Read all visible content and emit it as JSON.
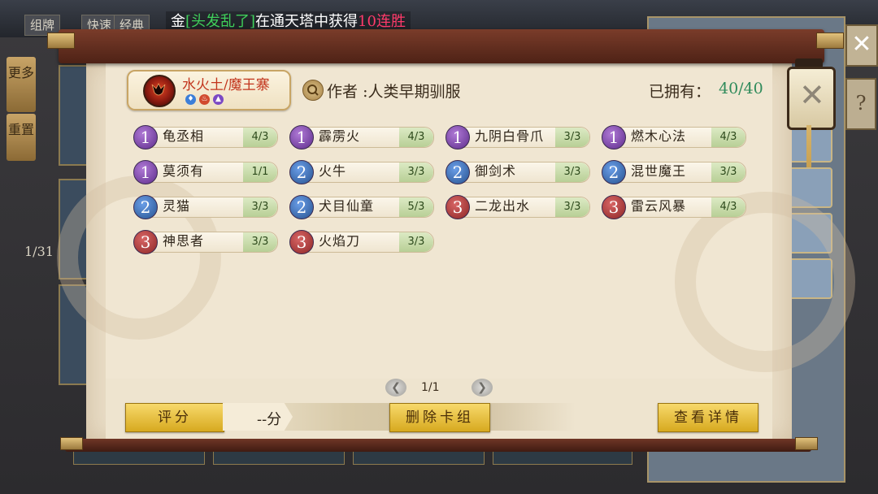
{
  "background": {
    "tabs": [
      "组牌",
      "快速",
      "经典"
    ],
    "side_buttons": [
      "更多",
      "重置"
    ],
    "page_indicator": "1/31",
    "marquee": {
      "prefix": "金",
      "name": "[头发乱了]",
      "text": "在通天塔中获得",
      "highlight": "10连胜"
    }
  },
  "deck": {
    "name": "水火土/魔王寨",
    "elements": [
      {
        "icon": "water-icon",
        "color": "#3d7fd8",
        "glyph": "♦"
      },
      {
        "icon": "fire-icon",
        "color": "#d14a2e",
        "glyph": "♨"
      },
      {
        "icon": "earth-icon",
        "color": "#7b4ac4",
        "glyph": "▲"
      }
    ],
    "author_label": "作者",
    "author_value": ":人类早期驯服",
    "owned_label": "已拥有：",
    "owned_value": "40/40"
  },
  "cards": [
    {
      "cost": "1",
      "name": "龟丞相",
      "count": "4/3"
    },
    {
      "cost": "1",
      "name": "霹雳火",
      "count": "4/3"
    },
    {
      "cost": "1",
      "name": "九阴白骨爪",
      "count": "3/3"
    },
    {
      "cost": "1",
      "name": "燃木心法",
      "count": "4/3"
    },
    {
      "cost": "1",
      "name": "莫须有",
      "count": "1/1"
    },
    {
      "cost": "2",
      "name": "火牛",
      "count": "3/3"
    },
    {
      "cost": "2",
      "name": "御剑术",
      "count": "3/3"
    },
    {
      "cost": "2",
      "name": "混世魔王",
      "count": "3/3"
    },
    {
      "cost": "2",
      "name": "灵猫",
      "count": "3/3"
    },
    {
      "cost": "2",
      "name": "犬目仙童",
      "count": "5/3"
    },
    {
      "cost": "3",
      "name": "二龙出水",
      "count": "3/3"
    },
    {
      "cost": "3",
      "name": "雷云风暴",
      "count": "4/3"
    },
    {
      "cost": "3",
      "name": "神思者",
      "count": "3/3"
    },
    {
      "cost": "3",
      "name": "火焰刀",
      "count": "3/3"
    }
  ],
  "footer": {
    "page": "1/1",
    "rate_label": "评分",
    "score": "--分",
    "delete_label": "删除卡组",
    "details_label": "查看详情"
  },
  "colors": {
    "cost_1": "#7a45b0",
    "cost_2": "#3a6fb8",
    "cost_3": "#b03838",
    "owned": "#2f8b5b"
  }
}
